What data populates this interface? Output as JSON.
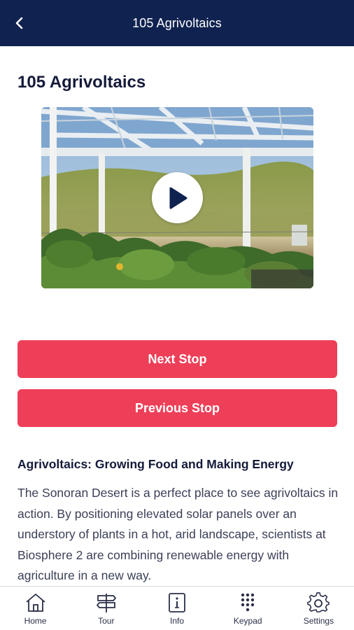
{
  "header": {
    "title": "105 Agrivoltaics",
    "back_icon": "chevron-left-icon"
  },
  "page": {
    "title": "105 Agrivoltaics"
  },
  "video": {
    "play_icon": "play-icon"
  },
  "actions": {
    "next_label": "Next Stop",
    "previous_label": "Previous Stop"
  },
  "content": {
    "heading": "Agrivoltaics: Growing Food and Making Energy",
    "body": "The Sonoran Desert is a perfect place to see agrivoltaics in action. By positioning elevated solar panels over an understory of plants in a hot, arid landscape, scientists at Biosphere 2 are combining renewable energy with agriculture in a new way."
  },
  "nav": {
    "items": [
      {
        "label": "Home",
        "icon": "home-icon"
      },
      {
        "label": "Tour",
        "icon": "signpost-icon"
      },
      {
        "label": "Info",
        "icon": "info-icon"
      },
      {
        "label": "Keypad",
        "icon": "keypad-icon"
      },
      {
        "label": "Settings",
        "icon": "gear-icon"
      }
    ]
  },
  "colors": {
    "header_bg": "#10224f",
    "accent": "#ee3f58",
    "text_dark": "#141a3a"
  }
}
